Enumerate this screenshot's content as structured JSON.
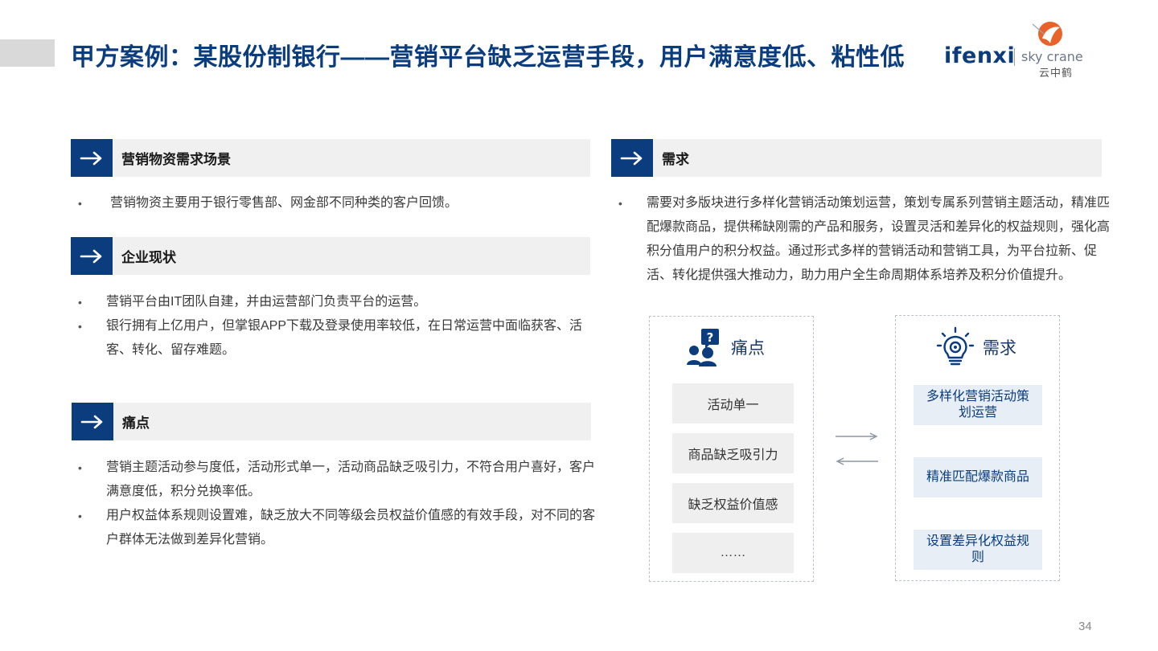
{
  "slide": {
    "title": "甲方案例：某股份制银行——营销平台缺乏运营手段，用户满意度低、粘性低",
    "page_number": "34"
  },
  "logo": {
    "brand1": "ifenxi",
    "brand2": "sky crane",
    "brand2_cn": "云中鹤"
  },
  "left": {
    "section1": {
      "label": "营销物资需求场景",
      "bullets": [
        "营销物资主要用于银行零售部、网金部不同种类的客户回馈。"
      ]
    },
    "section2": {
      "label": "企业现状",
      "bullets": [
        "营销平台由IT团队自建，并由运营部门负责平台的运营。",
        "银行拥有上亿用户，但掌银APP下载及登录使用率较低，在日常运营中面临获客、活客、转化、留存难题。"
      ]
    },
    "section3": {
      "label": "痛点",
      "bullets": [
        "营销主题活动参与度低，活动形式单一，活动商品缺乏吸引力，不符合用户喜好，客户满意度低，积分兑换率低。",
        "用户权益体系规则设置难，缺乏放大不同等级会员权益价值感的有效手段，对不同的客户群体无法做到差异化营销。"
      ]
    }
  },
  "right": {
    "section": {
      "label": "需求",
      "bullets": [
        "需要对多版块进行多样化营销活动策划运营，策划专属系列营销主题活动，精准匹配爆款商品，提供稀缺刚需的产品和服务，设置灵活和差异化的权益规则，强化高积分值用户的积分权益。通过形式多样的营销活动和营销工具，为平台拉新、促活、转化提供强大推动力，助力用户全生命周期体系培养及积分价值提升。"
      ]
    },
    "pain_box": {
      "title": "痛点",
      "items": [
        "活动单一",
        "商品缺乏吸引力",
        "缺乏权益价值感",
        "……"
      ]
    },
    "need_box": {
      "title": "需求",
      "items": [
        "多样化营销活动策划运营",
        "精准匹配爆款商品",
        "设置差异化权益规则"
      ]
    }
  },
  "colors": {
    "primary": "#0b3d7e",
    "header_bg": "#f0f0f0",
    "need_item_bg": "#e7eef6",
    "pain_item_bg": "#efefef"
  },
  "icons": [
    "arrow-right-icon",
    "people-question-icon",
    "lightbulb-gear-icon",
    "swap-arrows-icon",
    "crane-logo-icon"
  ]
}
